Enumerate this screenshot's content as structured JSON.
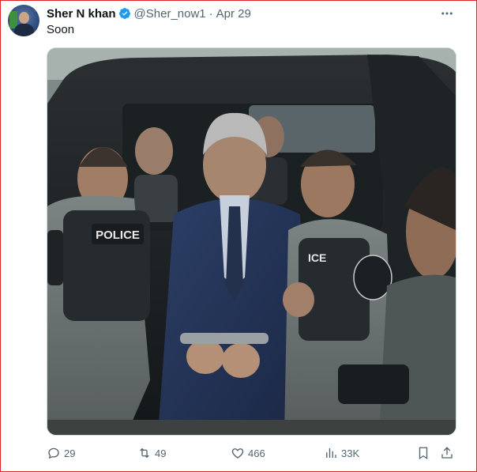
{
  "post": {
    "author_name": "Sher N khan",
    "handle": "@Sher_now1",
    "separator": "·",
    "date": "Apr 29",
    "text": "Soon",
    "media_patch": "POLICE",
    "media_patch_2": "ICE"
  },
  "actions": {
    "replies": "29",
    "reposts": "49",
    "likes": "466",
    "views": "33K"
  },
  "colors": {
    "verified": "#1d9bf0",
    "frame_border": "#e0262b",
    "muted_text": "#536471"
  },
  "icons": [
    "verified-badge-icon",
    "more-icon",
    "reply-icon",
    "repost-icon",
    "like-icon",
    "views-icon",
    "bookmark-icon",
    "share-icon"
  ]
}
